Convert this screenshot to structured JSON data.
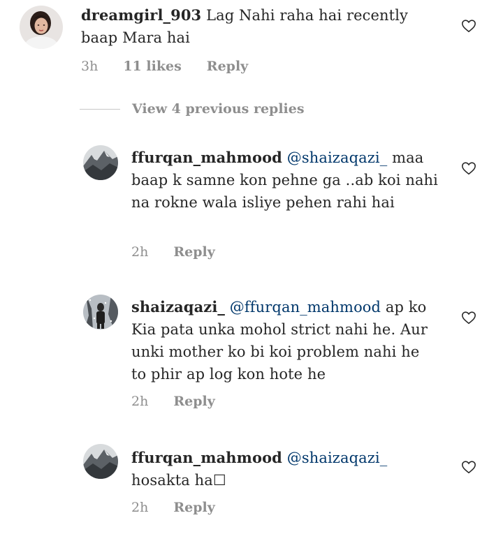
{
  "comments": [
    {
      "username": "dreamgirl_903",
      "mention": "",
      "text": "Lag Nahi raha hai recently baap Mara hai",
      "time": "3h",
      "likes": "11 likes",
      "reply_label": "Reply",
      "avatar_icon": "profile-photo-woman",
      "like_icon": "heart-outline-icon"
    },
    {
      "username": "ffurqan_mahmood",
      "mention": "@shaizaqazi_",
      "text": "maa baap k samne kon pehne ga ..ab koi nahi na rokne wala isliye pehen rahi hai",
      "time": "2h",
      "reply_label": "Reply",
      "avatar_icon": "profile-photo-landscape",
      "like_icon": "heart-outline-icon"
    },
    {
      "username": "shaizaqazi_",
      "mention": "@ffurqan_mahmood",
      "text": "ap ko Kia pata unka mohol strict nahi he. Aur unki mother ko bi koi problem nahi he to phir ap log kon hote he",
      "time": "2h",
      "reply_label": "Reply",
      "avatar_icon": "profile-photo-snow",
      "like_icon": "heart-outline-icon"
    },
    {
      "username": "ffurqan_mahmood",
      "mention": "@shaizaqazi_",
      "text": "hosakta ha☐",
      "time": "2h",
      "reply_label": "Reply",
      "avatar_icon": "profile-photo-landscape",
      "like_icon": "heart-outline-icon"
    }
  ],
  "view_previous_replies": "View 4 previous replies",
  "colors": {
    "text": "#262626",
    "mention": "#00376b",
    "secondary": "#8e8e8e",
    "divider": "#c7c7c7"
  }
}
